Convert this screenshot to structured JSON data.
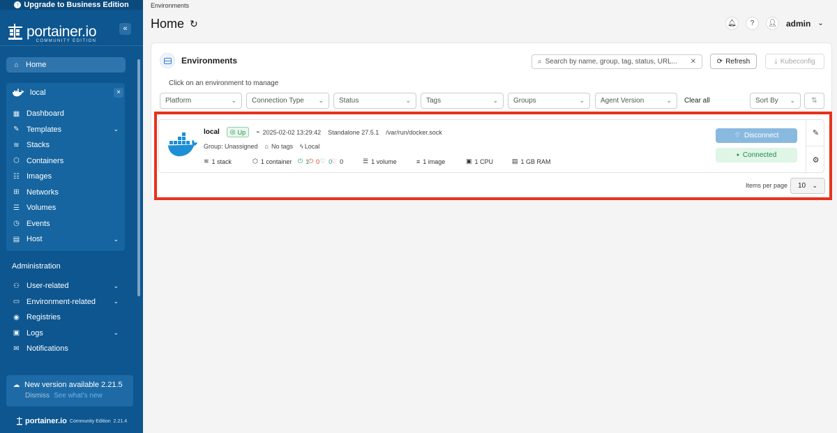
{
  "sidebar": {
    "upgrade_label": "Upgrade to Business Edition",
    "brand_name": "portainer.io",
    "brand_sub": "COMMUNITY EDITION",
    "collapse_glyph": "«",
    "home_label": "Home",
    "env_name": "local",
    "env_close": "×",
    "env_items": [
      {
        "label": "Dashboard",
        "icon": "dashboard-icon",
        "chevron": ""
      },
      {
        "label": "Templates",
        "icon": "templates-icon",
        "chevron": "⌄"
      },
      {
        "label": "Stacks",
        "icon": "stacks-icon",
        "chevron": ""
      },
      {
        "label": "Containers",
        "icon": "containers-icon",
        "chevron": ""
      },
      {
        "label": "Images",
        "icon": "images-icon",
        "chevron": ""
      },
      {
        "label": "Networks",
        "icon": "networks-icon",
        "chevron": ""
      },
      {
        "label": "Volumes",
        "icon": "volumes-icon",
        "chevron": ""
      },
      {
        "label": "Events",
        "icon": "events-icon",
        "chevron": ""
      },
      {
        "label": "Host",
        "icon": "host-icon",
        "chevron": "⌄"
      }
    ],
    "admin_title": "Administration",
    "admin_items": [
      {
        "label": "User-related",
        "icon": "users-icon",
        "chevron": "⌄"
      },
      {
        "label": "Environment-related",
        "icon": "environment-icon",
        "chevron": "⌄"
      },
      {
        "label": "Registries",
        "icon": "registries-icon",
        "chevron": ""
      },
      {
        "label": "Logs",
        "icon": "logs-icon",
        "chevron": "⌄"
      },
      {
        "label": "Notifications",
        "icon": "notifications-icon",
        "chevron": ""
      }
    ],
    "new_version_text": "New version available 2.21.5",
    "dismiss_label": "Dismiss",
    "see_whats_new_label": "See what's new",
    "footer_brand": "portainer.io",
    "footer_edition": "Community Edition",
    "footer_version": "2.21.4"
  },
  "header": {
    "breadcrumb": "Environments",
    "title": "Home",
    "user": "admin"
  },
  "panel": {
    "title": "Environments",
    "search_placeholder": "Search by name, group, tag, status, URL...",
    "refresh_label": "Refresh",
    "kubeconfig_label": "Kubeconfig",
    "hint": "Click on an environment to manage",
    "filters": [
      "Platform",
      "Connection Type",
      "Status",
      "Tags",
      "Groups",
      "Agent Version"
    ],
    "clear_all": "Clear all",
    "sort_by": "Sort By",
    "items_per_page_label": "Items per page",
    "items_per_page_value": "10"
  },
  "environment": {
    "name": "local",
    "status": "Up",
    "timestamp": "2025-02-02 13:29:42",
    "type": "Standalone 27.5.1",
    "url": "/var/run/docker.sock",
    "group": "Group: Unassigned",
    "tags": "No tags",
    "location": "Local",
    "stacks": "1 stack",
    "containers": "1 container",
    "running": "1",
    "stopped": "0",
    "healthy": "0",
    "unhealthy": "0",
    "volumes": "1 volume",
    "images": "1 image",
    "cpu": "1 CPU",
    "ram": "1 GB RAM",
    "disconnect_label": "Disconnect",
    "connected_label": "Connected"
  },
  "colors": {
    "sidebar": "#0d5690",
    "highlight": "#e8321c",
    "docker": "#1d8fd6"
  }
}
